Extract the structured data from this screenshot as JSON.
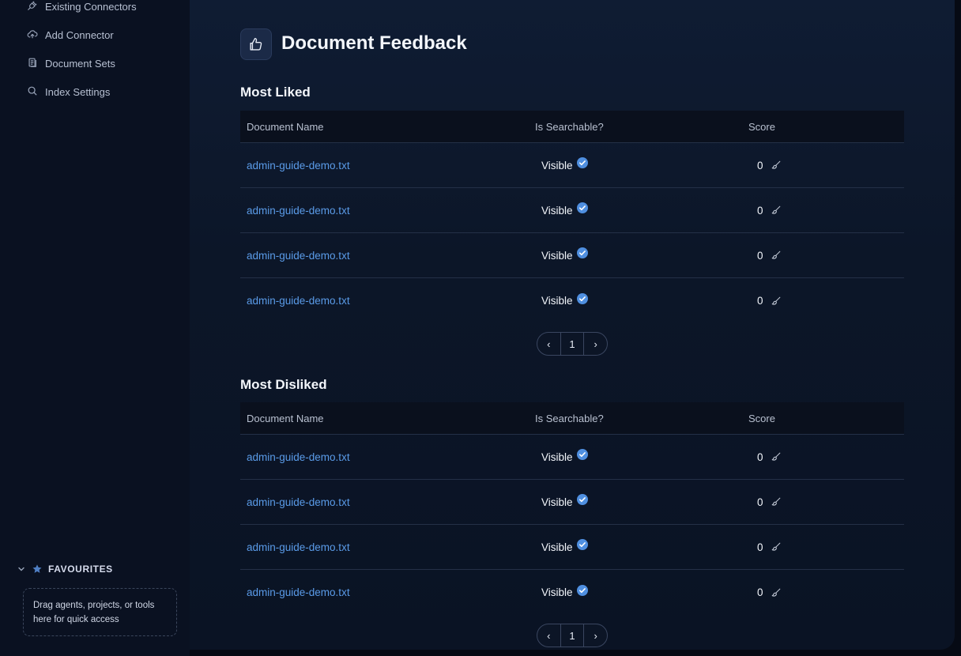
{
  "sidebar": {
    "items": [
      {
        "label": "Existing Connectors",
        "icon": "plug-icon"
      },
      {
        "label": "Add Connector",
        "icon": "cloud-upload-icon"
      },
      {
        "label": "Document Sets",
        "icon": "documents-icon"
      },
      {
        "label": "Index Settings",
        "icon": "search-icon"
      }
    ],
    "favourites": {
      "title": "FAVOURITES",
      "placeholder": "Drag agents, projects, or tools here for quick access"
    }
  },
  "page": {
    "title": "Document Feedback",
    "icon": "thumbs-up-icon"
  },
  "columns": {
    "name": "Document Name",
    "searchable": "Is Searchable?",
    "score": "Score"
  },
  "most_liked": {
    "title": "Most Liked",
    "rows": [
      {
        "name": "admin-guide-demo.txt",
        "searchable": "Visible",
        "score": "0"
      },
      {
        "name": "admin-guide-demo.txt",
        "searchable": "Visible",
        "score": "0"
      },
      {
        "name": "admin-guide-demo.txt",
        "searchable": "Visible",
        "score": "0"
      },
      {
        "name": "admin-guide-demo.txt",
        "searchable": "Visible",
        "score": "0"
      }
    ],
    "pagination": {
      "prev": "‹",
      "page": "1",
      "next": "›"
    }
  },
  "most_disliked": {
    "title": "Most Disliked",
    "rows": [
      {
        "name": "admin-guide-demo.txt",
        "searchable": "Visible",
        "score": "0"
      },
      {
        "name": "admin-guide-demo.txt",
        "searchable": "Visible",
        "score": "0"
      },
      {
        "name": "admin-guide-demo.txt",
        "searchable": "Visible",
        "score": "0"
      },
      {
        "name": "admin-guide-demo.txt",
        "searchable": "Visible",
        "score": "0"
      }
    ],
    "pagination": {
      "prev": "‹",
      "page": "1",
      "next": "›"
    }
  },
  "colors": {
    "link": "#5a9be8",
    "check": "#4f8fe0",
    "background": "#0c1628"
  }
}
